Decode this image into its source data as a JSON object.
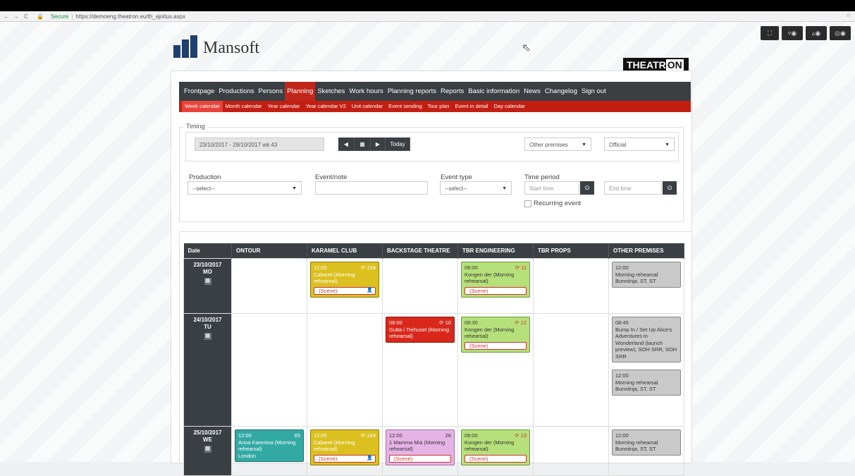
{
  "browser": {
    "secure_label": "Secure",
    "url": "https://demoeng.theatron.eu/th_ajoitus.aspx"
  },
  "brand": {
    "name": "Mansoft",
    "theatron_a": "THEATR",
    "theatron_b": "ON"
  },
  "tools": [
    "⛶",
    "▿◉",
    "▵◉",
    "◎◉"
  ],
  "main_nav": [
    "Frontpage",
    "Productions",
    "Persons",
    "Planning",
    "Sketches",
    "Work hours",
    "Planning reports",
    "Reports",
    "Basic information",
    "News",
    "Changelog",
    "Sign out"
  ],
  "sub_nav": [
    "Week calendar",
    "Month calendar",
    "Year calendar",
    "Year calendar V2",
    "Unit calendar",
    "Event sending",
    "Tour plan",
    "Event in detail",
    "Day calendar"
  ],
  "timing": {
    "legend": "Timing",
    "date_range": "23/10/2017 - 29/10/2017 wk 43",
    "today_label": "Today",
    "premises_select": "Other premises",
    "status_select": "Official"
  },
  "filters": {
    "production_label": "Production",
    "production_value": "--select--",
    "event_note_label": "Event/note",
    "event_type_label": "Event type",
    "event_type_value": "--select--",
    "time_period_label": "Time period",
    "start_placeholder": "Start time",
    "end_placeholder": "End time",
    "recurring_label": "Recurring event"
  },
  "calendar": {
    "headers": [
      "Date",
      "ONTOUR",
      "KARAMEL CLUB",
      "BACKSTAGE THEATRE",
      "TBR ENGINEERING",
      "TBR PROPS",
      "OTHER PREMISES"
    ],
    "rows": [
      {
        "date": "23/10/2017",
        "day": "MO",
        "karamel": {
          "time": "12:00",
          "num": "158",
          "title": "Cabaret (Morning rehearsal)",
          "scene": "(Scene)"
        },
        "tbr_eng": {
          "time": "09:00",
          "num": "11",
          "title": "Kongen der (Morning rehearsal)",
          "scene": "(Scene)"
        },
        "other": [
          {
            "time": "12:00",
            "title": "Morning rehearsal Bunniinja, ST, ST"
          }
        ]
      },
      {
        "date": "24/10/2017",
        "day": "TU",
        "backstage": {
          "time": "09:00",
          "num": "10",
          "title": "Gutta i Trehuset (Morning rehearsal)"
        },
        "tbr_eng": {
          "time": "09:30",
          "num": "12",
          "title": "Kongen der (Morning rehearsal)",
          "scene": "(Scene)"
        },
        "other": [
          {
            "time": "08:45",
            "title": "Bump In / Set Up Alice's Adventures in Wonderland (launch preview), SOH SRR, SOH SRR"
          },
          {
            "time": "12:00",
            "title": "Morning rehearsal Bunniinja, ST, ST"
          }
        ]
      },
      {
        "date": "25/10/2017",
        "day": "WE",
        "ontour": {
          "time": "12:00",
          "num": "65",
          "title": "Anna Karenina (Morning rehearsal)",
          "place": "London"
        },
        "karamel": {
          "time": "12:00",
          "num": "159",
          "title": "Cabaret (Morning rehearsal)",
          "scene": "(Scene)"
        },
        "backstage": {
          "time": "12:00",
          "num": "26",
          "title": "1 Mamma Mia (Morning rehearsal)",
          "scene": "(Scene)"
        },
        "tbr_eng": {
          "time": "09:00",
          "num": "13",
          "title": "Kongen der (Morning rehearsal)",
          "scene": "(Scene)"
        },
        "other": [
          {
            "time": "12:00",
            "title": "Morning rehearsal Bunniinja, ST, ST"
          }
        ]
      }
    ]
  }
}
